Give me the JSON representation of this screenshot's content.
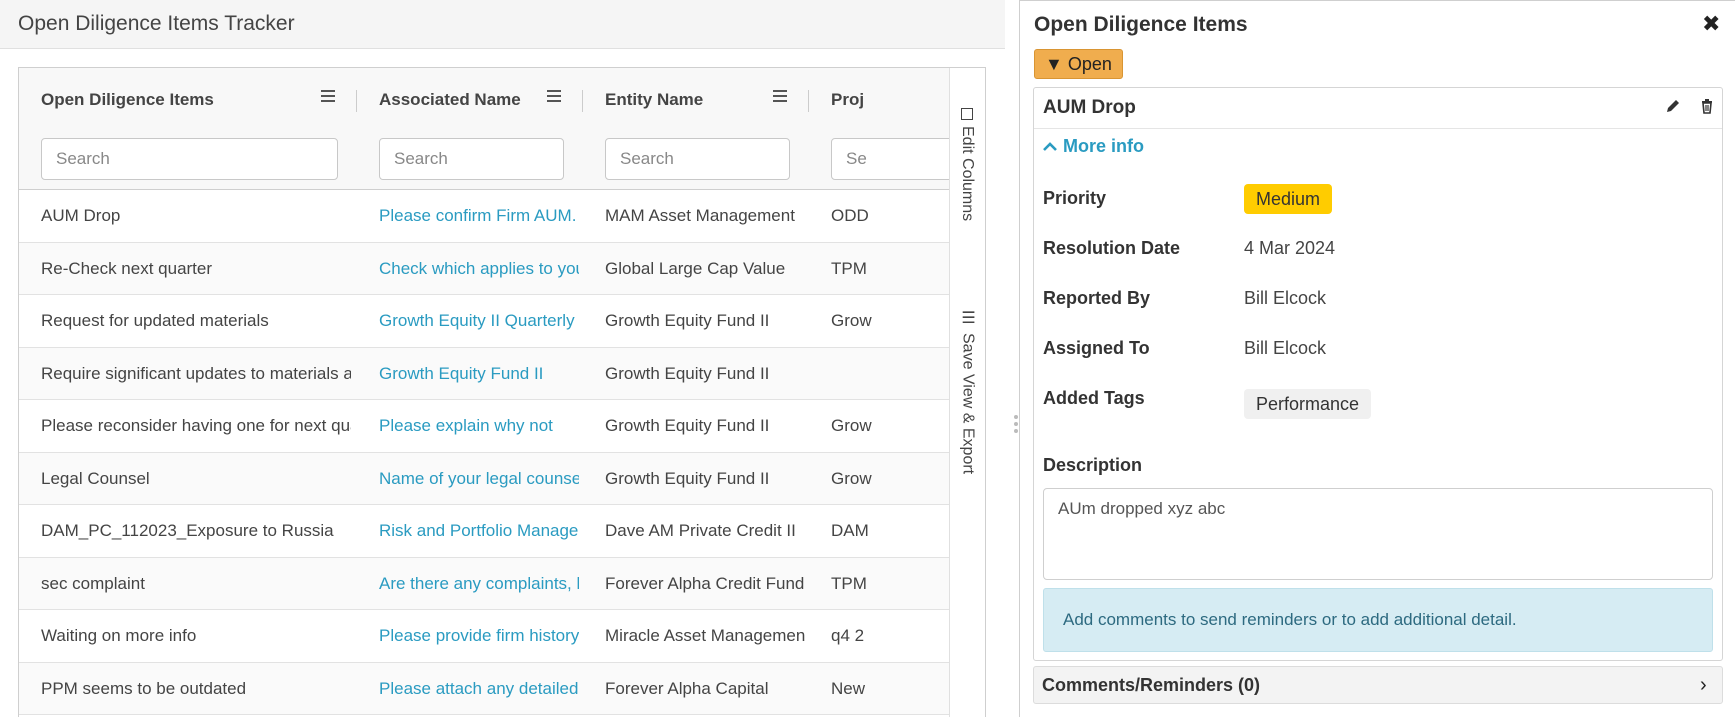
{
  "left": {
    "title": "Open Diligence Items Tracker",
    "columns": [
      {
        "label": "Open Diligence Items",
        "placeholder": "Search"
      },
      {
        "label": "Associated Name",
        "placeholder": "Search"
      },
      {
        "label": "Entity Name",
        "placeholder": "Search"
      },
      {
        "label": "Proj",
        "placeholder": "Se"
      }
    ],
    "rows": [
      {
        "item": "AUM Drop",
        "assoc": "Please confirm Firm AUM.",
        "entity": "MAM Asset Management",
        "proj": "ODD"
      },
      {
        "item": "Re-Check next quarter",
        "assoc": "Check which applies to you",
        "entity": "Global Large Cap Value",
        "proj": "TPM"
      },
      {
        "item": "Request for updated materials",
        "assoc": "Growth Equity II Quarterly",
        "entity": "Growth Equity Fund II",
        "proj": "Grow"
      },
      {
        "item": "Require significant updates to materials an",
        "assoc": "Growth Equity Fund II",
        "entity": "Growth Equity Fund II",
        "proj": ""
      },
      {
        "item": "Please reconsider having one for next quar",
        "assoc": "Please explain why not",
        "entity": "Growth Equity Fund II",
        "proj": "Grow"
      },
      {
        "item": "Legal Counsel",
        "assoc": "Name of your legal counsel",
        "entity": "Growth Equity Fund II",
        "proj": "Grow"
      },
      {
        "item": "DAM_PC_112023_Exposure to Russia",
        "assoc": "Risk and Portfolio Manage",
        "entity": "Dave AM Private Credit II",
        "proj": "DAM"
      },
      {
        "item": "sec complaint",
        "assoc": "Are there any complaints, l",
        "entity": "Forever Alpha Credit Fund",
        "proj": "TPM"
      },
      {
        "item": "Waiting on more info",
        "assoc": "Please provide firm history",
        "entity": "Miracle Asset Managemen",
        "proj": "q4 2"
      },
      {
        "item": "PPM seems to be outdated",
        "assoc": "Please attach any detailed",
        "entity": "Forever Alpha Capital",
        "proj": "New"
      }
    ],
    "side_tabs": {
      "edit_columns": "Edit Columns",
      "save_view": "Save View & Export"
    }
  },
  "right": {
    "title": "Open Diligence Items",
    "close_glyph": "✖",
    "status_label": "▼ Open",
    "item": {
      "name": "AUM Drop",
      "more_info": "More info",
      "priority_label": "Priority",
      "priority_value": "Medium",
      "resolution_label": "Resolution Date",
      "resolution_value": "4 Mar 2024",
      "reported_label": "Reported By",
      "reported_value": "Bill Elcock",
      "assigned_label": "Assigned To",
      "assigned_value": "Bill Elcock",
      "tags_label": "Added Tags",
      "tag": "Performance",
      "description_label": "Description",
      "description": "AUm dropped xyz abc",
      "info_alert": "Add comments to send reminders or to add additional detail."
    },
    "comments_label": "Comments/Reminders (0)"
  },
  "colors": {
    "link": "#2a9bc1",
    "warning": "#f0ad4e",
    "medium_badge": "#ffcc00",
    "info_bg": "#d6ecf3"
  }
}
